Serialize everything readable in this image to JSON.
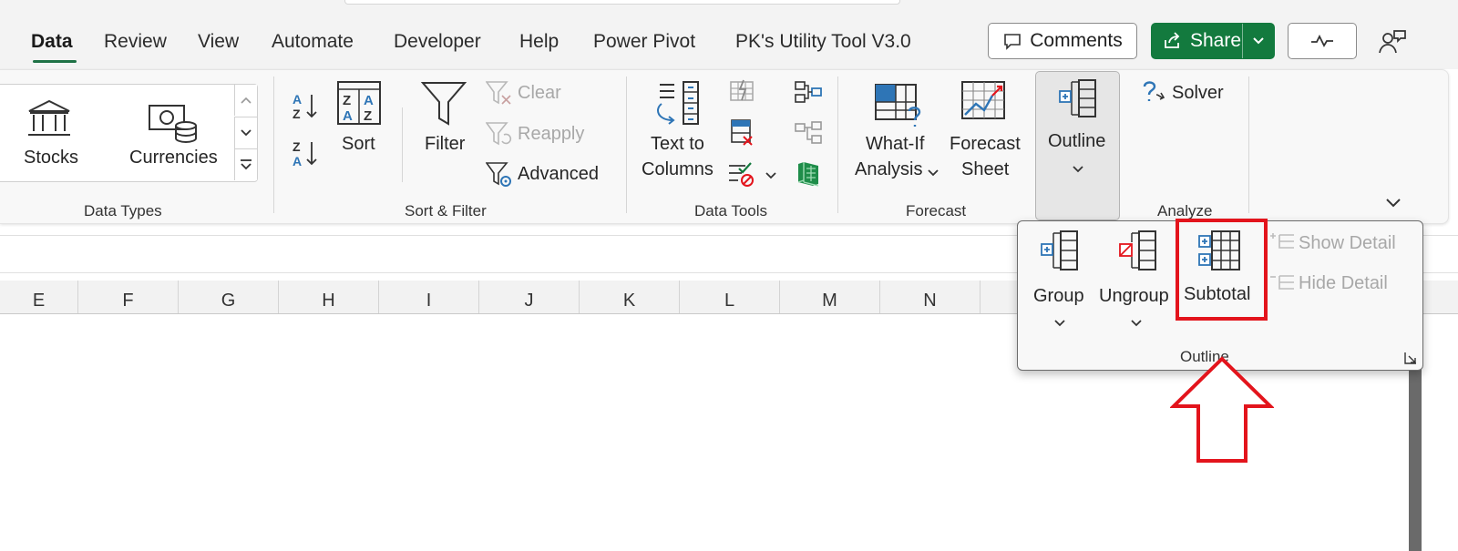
{
  "tabs": [
    "Data",
    "Review",
    "View",
    "Automate",
    "Developer",
    "Help",
    "Power Pivot",
    "PK's Utility Tool V3.0"
  ],
  "active_tab": "Data",
  "header_buttons": {
    "comments": "Comments",
    "share": "Share"
  },
  "ribbon": {
    "data_types": {
      "label": "Data Types",
      "stocks": "Stocks",
      "currencies": "Currencies"
    },
    "sort_filter": {
      "label": "Sort & Filter",
      "sort": "Sort",
      "filter": "Filter",
      "clear": "Clear",
      "reapply": "Reapply",
      "advanced": "Advanced"
    },
    "data_tools": {
      "label": "Data Tools",
      "text_to_columns_1": "Text to",
      "text_to_columns_2": "Columns"
    },
    "forecast": {
      "label": "Forecast",
      "what_if_1": "What-If",
      "what_if_2": "Analysis",
      "forecast_sheet_1": "Forecast",
      "forecast_sheet_2": "Sheet"
    },
    "outline_button": "Outline",
    "analyze": {
      "label": "Analyze",
      "solver": "Solver"
    }
  },
  "outline_menu": {
    "group": "Group",
    "ungroup": "Ungroup",
    "subtotal": "Subtotal",
    "show_detail": "Show Detail",
    "hide_detail": "Hide Detail",
    "label": "Outline"
  },
  "columns": [
    "E",
    "F",
    "G",
    "H",
    "I",
    "J",
    "K",
    "L",
    "M",
    "N"
  ],
  "colors": {
    "accent_green": "#137a3e",
    "highlight_red": "#e3141c",
    "icon_blue": "#2e75b6"
  }
}
